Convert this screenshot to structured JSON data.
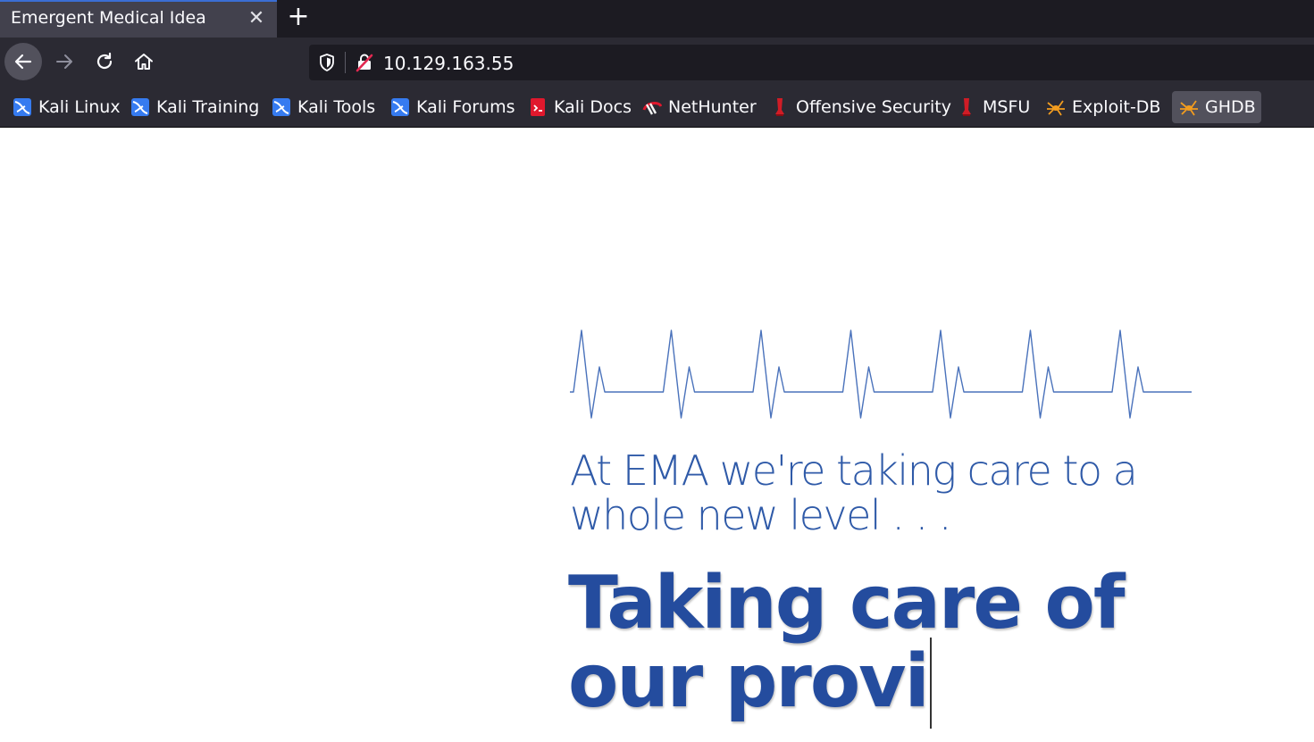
{
  "browser": {
    "tab_title": "Emergent Medical Idea",
    "tab_close_glyph": "✕",
    "new_tab_glyph": "+",
    "url": "10.129.163.55"
  },
  "bookmarks": [
    {
      "label": "Kali Linux",
      "icon": "kali-dragon-icon"
    },
    {
      "label": "Kali Training",
      "icon": "kali-dragon-icon"
    },
    {
      "label": "Kali Tools",
      "icon": "kali-dragon-icon"
    },
    {
      "label": "Kali Forums",
      "icon": "kali-dragon-icon"
    },
    {
      "label": "Kali Docs",
      "icon": "kali-docs-icon"
    },
    {
      "label": "NetHunter",
      "icon": "nethunter-icon"
    },
    {
      "label": "Offensive Security",
      "icon": "offsec-icon"
    },
    {
      "label": "MSFU",
      "icon": "offsec-icon"
    },
    {
      "label": "Exploit-DB",
      "icon": "exploitdb-spider-icon"
    },
    {
      "label": "GHDB",
      "icon": "exploitdb-spider-icon"
    }
  ],
  "page": {
    "intro": "At EMA we're taking care to a whole new level . . .",
    "headline_line1": "Taking care of",
    "headline_line2": "our provi"
  },
  "colors": {
    "accent": "#2f5aa8",
    "headline": "#244c9e",
    "chrome_dark": "#1c1b22",
    "chrome": "#2b2a33"
  }
}
